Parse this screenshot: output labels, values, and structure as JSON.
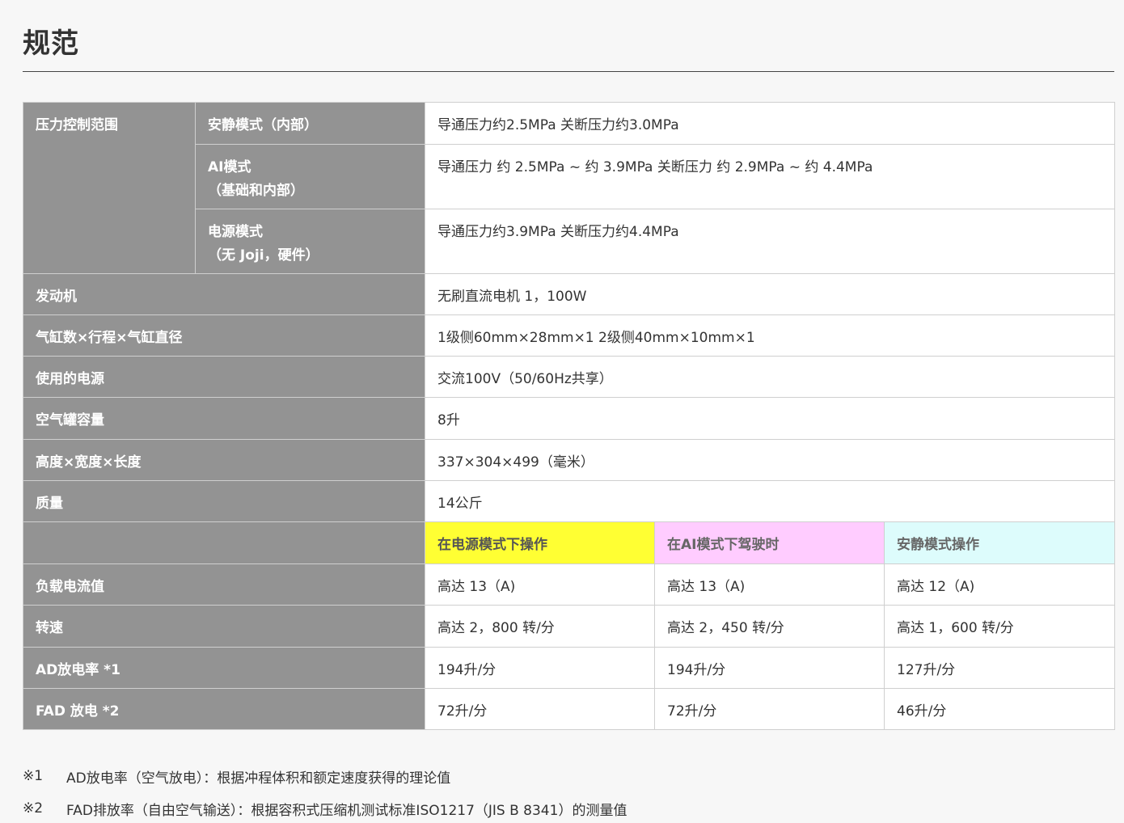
{
  "page": {
    "title": "规范"
  },
  "spec": {
    "pressure": {
      "label": "压力控制范围",
      "rows": [
        {
          "mode": "安静模式（内部）",
          "mode_line2": "",
          "value": "导通压力约2.5MPa 关断压力约3.0MPa"
        },
        {
          "mode": "AI模式",
          "mode_line2": "（基础和内部）",
          "value": "导通压力 约 2.5MPa ~ 约 3.9MPa 关断压力 约 2.9MPa ~ 约 4.4MPa"
        },
        {
          "mode": "电源模式",
          "mode_line2": "（无 Joji，硬件）",
          "value": "导通压力约3.9MPa 关断压力约4.4MPa"
        }
      ]
    },
    "rows": [
      {
        "label": "发动机",
        "value": "无刷直流电机 1，100W"
      },
      {
        "label": "气缸数×行程×气缸直径",
        "value": "1级侧60mm×28mm×1 2级侧40mm×10mm×1"
      },
      {
        "label": "使用的电源",
        "value": "交流100V（50/60Hz共享）"
      },
      {
        "label": "空气罐容量",
        "value": "8升"
      },
      {
        "label": "高度×宽度×长度",
        "value": "337×304×499（毫米）"
      },
      {
        "label": "质量",
        "value": "14公斤"
      }
    ],
    "modes": {
      "header_label": "",
      "power": "在电源模式下操作",
      "ai": "在AI模式下驾驶时",
      "quiet": "安静模式操作",
      "colors": {
        "power": "#ffff33",
        "ai": "#ffccff",
        "quiet": "#ddfcfc"
      }
    },
    "mode_rows": [
      {
        "label": "负载电流值",
        "power": "高达 13（A)",
        "ai": "高达 13（A)",
        "quiet": "高达 12（A)"
      },
      {
        "label": "转速",
        "power": "高达 2，800 转/分",
        "ai": "高达 2，450 转/分",
        "quiet": "高达 1，600 转/分"
      },
      {
        "label": "AD放电率 *1",
        "power": "194升/分",
        "ai": "194升/分",
        "quiet": "127升/分"
      },
      {
        "label": "FAD 放电 *2",
        "power": "72升/分",
        "ai": "72升/分",
        "quiet": "46升/分"
      }
    ]
  },
  "notes": [
    {
      "mark": "※1",
      "text": "AD放电率（空气放电）：根据冲程体积和额定速度获得的理论值"
    },
    {
      "mark": "※2",
      "text": "FAD排放率（自由空气输送）：根据容积式压缩机测试标准ISO1217（JIS B 8341）的测量值"
    }
  ]
}
